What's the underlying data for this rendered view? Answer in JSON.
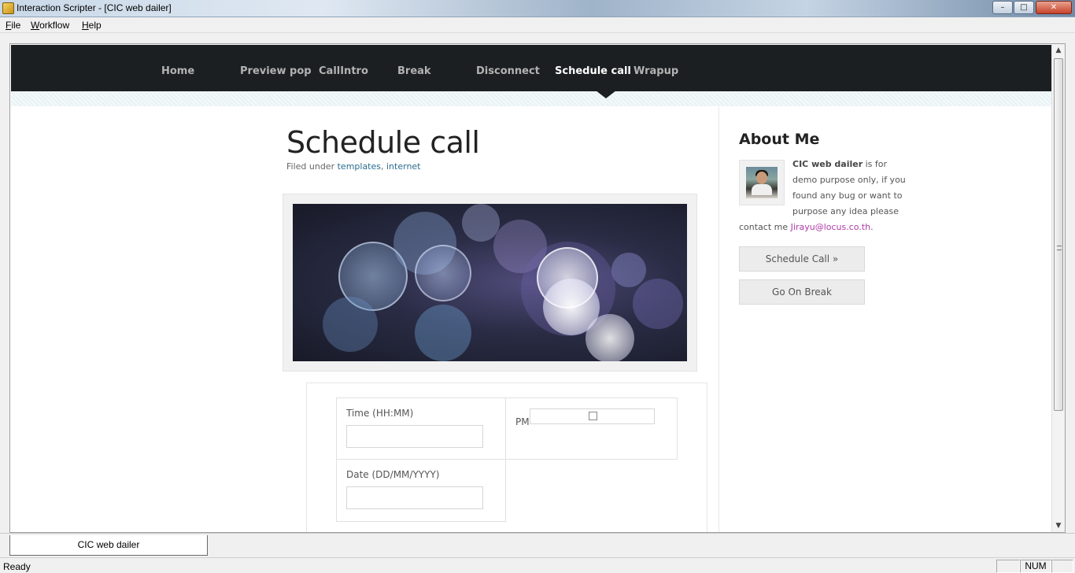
{
  "window": {
    "title": "Interaction Scripter - [CIC web dailer]",
    "controls": {
      "minimize": "–",
      "maximize": "□",
      "close": "✕"
    }
  },
  "menubar": [
    "File",
    "Workflow",
    "Help"
  ],
  "nav": {
    "items": [
      "Home",
      "Preview pop",
      "CallIntro",
      "Break",
      "Disconnect",
      "Schedule call",
      "Wrapup"
    ],
    "active": "Schedule call"
  },
  "page": {
    "title": "Schedule call",
    "filed_prefix": "Filed under",
    "tags": [
      "templates",
      "internet"
    ],
    "tag_separator": ","
  },
  "form": {
    "time_label": "Time (HH:MM)",
    "time_value": "",
    "ampm_label": "PM",
    "date_label": "Date (DD/MM/YYYY)",
    "date_value": ""
  },
  "sidebar": {
    "title": "About Me",
    "bio_name": "CIC web dailer",
    "bio_line1_rest": "is for",
    "bio_line2": "demo purpose only, if you",
    "bio_line3": "found any bug or want to",
    "bio_line4": "purpose any idea please",
    "bio_line5_prefix": "contact me",
    "email": "Jirayu@locus.co.th",
    "email_suffix": ".",
    "buttons": [
      "Schedule Call »",
      "Go On Break"
    ]
  },
  "mdi_tab": "CIC web dailer",
  "status": {
    "text": "Ready",
    "num": "NUM"
  },
  "colors": {
    "nav_bg": "#1c1f22",
    "link": "#2a6d8f",
    "email": "#b03aa8"
  }
}
